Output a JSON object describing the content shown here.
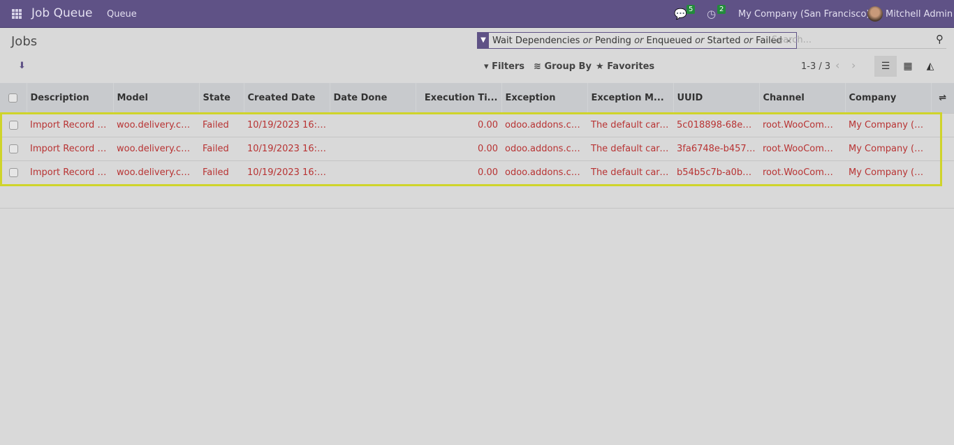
{
  "navbar": {
    "app_name": "Job Queue",
    "menu": "Queue",
    "messages_count": "5",
    "activities_count": "2",
    "company": "My Company (San Francisco)",
    "user": "Mitchell Admin"
  },
  "page": {
    "title": "Jobs"
  },
  "search": {
    "facet_parts": [
      "Wait Dependencies",
      "or",
      "Pending",
      "or",
      "Enqueued",
      "or",
      "Started",
      "or",
      "Failed"
    ],
    "remove": "×",
    "placeholder": "Search..."
  },
  "toolbar": {
    "filters": "Filters",
    "group_by": "Group By",
    "favorites": "Favorites",
    "pager": "1-3 / 3"
  },
  "table": {
    "columns": [
      "Description",
      "Model",
      "State",
      "Created Date",
      "Date Done",
      "Execution Ti...",
      "Exception",
      "Exception M...",
      "UUID",
      "Channel",
      "Company"
    ],
    "rows": [
      [
        "Import Record O...",
        "woo.delivery.carr...",
        "Failed",
        "10/19/2023 16:1...",
        "",
        "0.00",
        "odoo.addons.con...",
        "The default carri...",
        "5c018898-68e3-4...",
        "root.WooComme...",
        "My Company (Sa..."
      ],
      [
        "Import Record O...",
        "woo.delivery.carr...",
        "Failed",
        "10/19/2023 16:1...",
        "",
        "0.00",
        "odoo.addons.con...",
        "The default carri...",
        "3fa6748e-b457-4...",
        "root.WooComme...",
        "My Company (Sa..."
      ],
      [
        "Import Record O...",
        "woo.delivery.carr...",
        "Failed",
        "10/19/2023 16:1...",
        "",
        "0.00",
        "odoo.addons.con...",
        "The default carri...",
        "b54b5c7b-a0bb-4...",
        "root.WooComme...",
        "My Company (Sa..."
      ]
    ]
  }
}
